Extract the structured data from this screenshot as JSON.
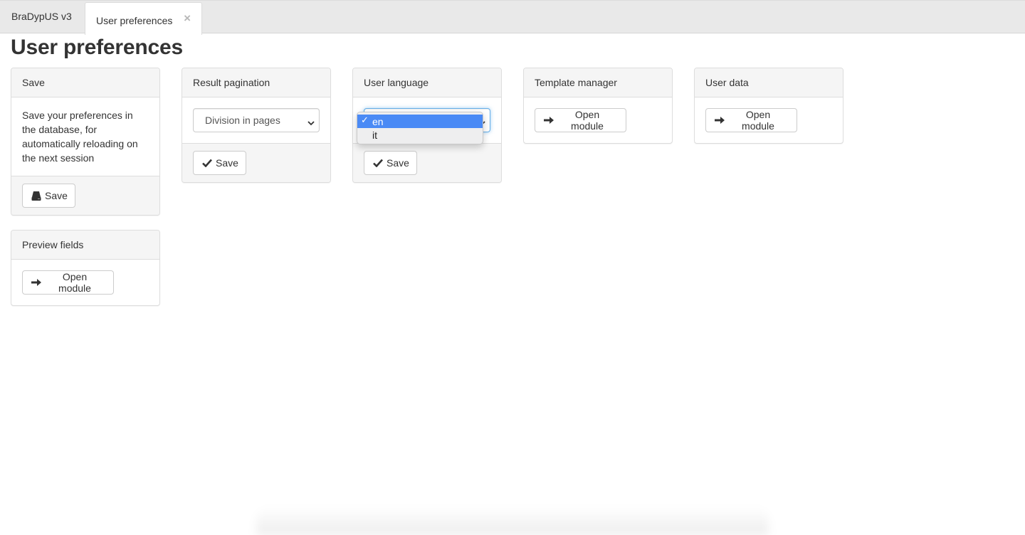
{
  "tabs": [
    {
      "label": "BraDypUS v3",
      "active": false
    },
    {
      "label": "User preferences",
      "active": true,
      "close_icon": "×"
    }
  ],
  "page_title": "User preferences",
  "panels": {
    "save": {
      "heading": "Save",
      "text": "Save your preferences in the database, for automatically reloading on the next session",
      "button_label": "Save",
      "button_icon": "hdd-icon"
    },
    "result_pagination": {
      "heading": "Result pagination",
      "select_value": "Division in pages",
      "button_label": "Save",
      "button_icon": "check-icon"
    },
    "user_language": {
      "heading": "User language",
      "select_value": "en",
      "options": [
        {
          "label": "en",
          "selected": true
        },
        {
          "label": "it",
          "selected": false
        }
      ],
      "check_mark": "✓",
      "button_label": "Save",
      "button_icon": "check-icon"
    },
    "template_manager": {
      "heading": "Template manager",
      "button_label": "Open module",
      "button_icon": "arrow-right-icon"
    },
    "user_data": {
      "heading": "User data",
      "button_label": "Open module",
      "button_icon": "arrow-right-icon"
    },
    "preview_fields": {
      "heading": "Preview fields",
      "button_label": "Open module",
      "button_icon": "arrow-right-icon"
    }
  },
  "colors": {
    "selected_option": "#4a8af5",
    "focus_border": "#66afe9",
    "panel_heading_bg": "#f5f5f5",
    "tabbar_bg": "#e9e9e9"
  }
}
